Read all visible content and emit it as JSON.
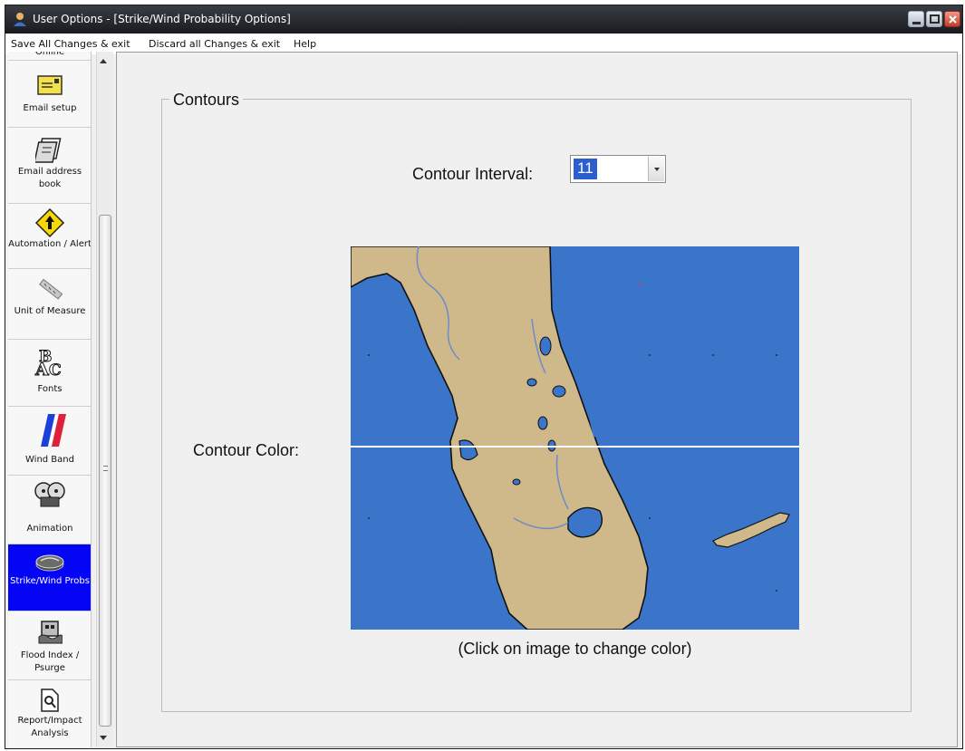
{
  "window": {
    "title": "User Options - [Strike/Wind Probability Options]"
  },
  "menu": {
    "save": "Save All Changes & exit",
    "discard": "Discard all Changes & exit",
    "help": "Help"
  },
  "sidebar": {
    "items": [
      {
        "label": "Online",
        "icon": "online-icon"
      },
      {
        "label": "Email setup",
        "icon": "envelope-icon"
      },
      {
        "label": "Email address book",
        "icon": "address-book-icon"
      },
      {
        "label": "Automation / Alert",
        "icon": "warning-sign-icon"
      },
      {
        "label": "Unit of Measure",
        "icon": "ruler-icon"
      },
      {
        "label": "Fonts",
        "icon": "fonts-icon"
      },
      {
        "label": "Wind Band",
        "icon": "wind-band-icon"
      },
      {
        "label": "Animation",
        "icon": "film-reel-icon"
      },
      {
        "label": "Strike/Wind Probs",
        "icon": "strike-wind-icon",
        "active": true
      },
      {
        "label": "Flood Index / Psurge",
        "icon": "flood-icon"
      },
      {
        "label": "Report/Impact Analysis",
        "icon": "report-icon"
      }
    ]
  },
  "contours": {
    "group_title": "Contours",
    "interval_label": "Contour Interval:",
    "interval_value": "11",
    "color_label": "Contour Color:",
    "hint": "(Click on image to change color)",
    "contour_color": "#ffffff"
  },
  "colors": {
    "ocean": "#3b75c9",
    "land": "#cfb98a",
    "active_sidebar": "#0505f5"
  }
}
